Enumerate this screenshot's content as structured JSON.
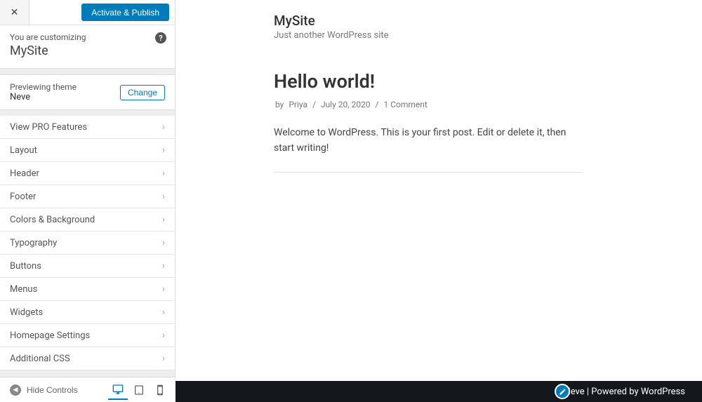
{
  "header": {
    "publish_label": "Activate & Publish"
  },
  "customizing": {
    "label": "You are customizing",
    "site_name": "MySite"
  },
  "theme": {
    "label": "Previewing theme",
    "name": "Neve",
    "change_label": "Change"
  },
  "panels": [
    "View PRO Features",
    "Layout",
    "Header",
    "Footer",
    "Colors & Background",
    "Typography",
    "Buttons",
    "Menus",
    "Widgets",
    "Homepage Settings",
    "Additional CSS"
  ],
  "footer": {
    "hide_controls": "Hide Controls"
  },
  "preview": {
    "site_title": "MySite",
    "site_tagline": "Just another WordPress site",
    "post_title": "Hello world!",
    "meta_by": "by",
    "meta_author": "Priya",
    "meta_date": "July 20, 2020",
    "meta_comments": "1 Comment",
    "post_body": "Welcome to WordPress. This is your first post. Edit or delete it, then start writing!",
    "footer_text": "Neve | Powered by WordPress"
  }
}
